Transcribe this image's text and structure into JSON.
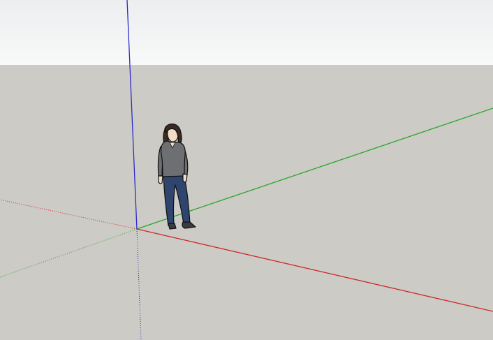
{
  "viewport": {
    "sky_top_color": "#eceeef",
    "sky_bottom_color": "#f8f9f9",
    "ground_color": "#cccbc6",
    "axis_colors": {
      "red": "#cc2b2b",
      "green": "#2aa52a",
      "blue": "#2b2bcc"
    },
    "figure": {
      "icon": "person-figure-icon",
      "hair_color": "#3a2a22",
      "skin_color": "#f1dcc7",
      "shirt_color": "#6e6f72",
      "jeans_color": "#2f456d",
      "shoe_color": "#3b3b3d"
    }
  }
}
